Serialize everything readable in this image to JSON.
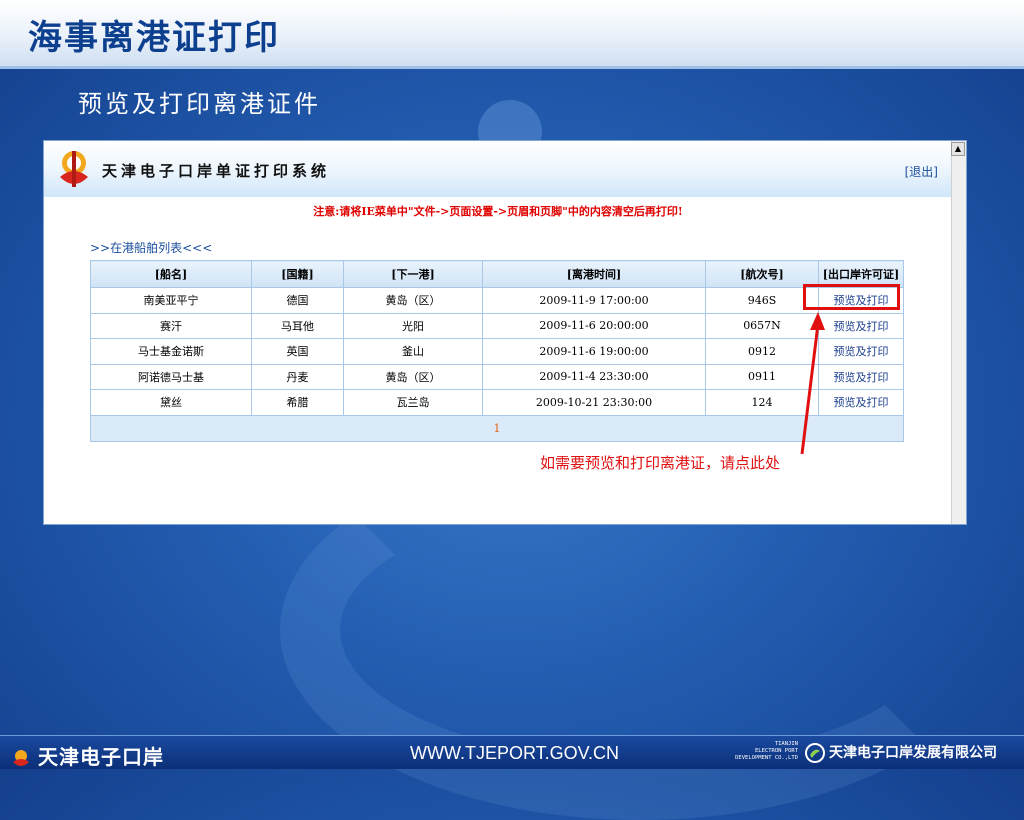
{
  "slide": {
    "title": "海事离港证打印",
    "subtitle": "预览及打印离港证件"
  },
  "app": {
    "title": "天津电子口岸单证打印系统",
    "logout_label": "[退出]",
    "notice": "注意:请将IE菜单中\"文件->页面设置->页眉和页脚\"中的内容清空后再打印!",
    "list_title": ">>在港船舶列表<<<",
    "table": {
      "headers": [
        "[船名]",
        "[国籍]",
        "[下一港]",
        "[离港时间]",
        "[航次号]",
        "[出口岸许可证]"
      ],
      "rows": [
        {
          "name": "南美亚平宁",
          "nationality": "德国",
          "next_port": "黄岛（区）",
          "departure": "2009-11-9 17:00:00",
          "voyage": "946S",
          "action": "预览及打印"
        },
        {
          "name": "赛汗",
          "nationality": "马耳他",
          "next_port": "光阳",
          "departure": "2009-11-6 20:00:00",
          "voyage": "0657N",
          "action": "预览及打印"
        },
        {
          "name": "马士基金诺斯",
          "nationality": "英国",
          "next_port": "釜山",
          "departure": "2009-11-6 19:00:00",
          "voyage": "0912",
          "action": "预览及打印"
        },
        {
          "name": "阿诺德马士基",
          "nationality": "丹麦",
          "next_port": "黄岛（区）",
          "departure": "2009-11-4 23:30:00",
          "voyage": "0911",
          "action": "预览及打印"
        },
        {
          "name": "黛丝",
          "nationality": "希腊",
          "next_port": "瓦兰岛",
          "departure": "2009-10-21 23:30:00",
          "voyage": "124",
          "action": "预览及打印"
        }
      ],
      "page": "1"
    }
  },
  "annotation": {
    "text": "如需要预览和打印离港证，请点此处",
    "color": "#e01010"
  },
  "footer": {
    "brand": "天津电子口岸",
    "url": "WWW.TJEPORT.GOV.CN",
    "en_lines": [
      "TIANJIN",
      "ELECTRON PORT",
      "DEVELOPMENT CO.,LTD"
    ],
    "company": "天津电子口岸发展有限公司"
  },
  "icons": [
    "tianjin-eport-logo-icon",
    "scroll-up-arrow-icon",
    "red-arrow-icon",
    "company-logo-icon"
  ]
}
